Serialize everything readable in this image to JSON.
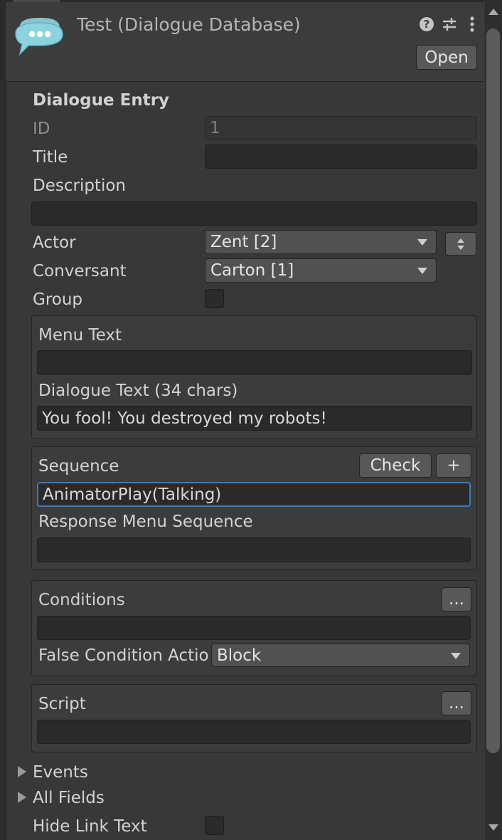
{
  "header": {
    "title": "Test (Dialogue Database)",
    "open_label": "Open",
    "icons": [
      "help-icon",
      "settings-sliders-icon",
      "kebab-menu-icon"
    ]
  },
  "entry": {
    "section_title": "Dialogue Entry",
    "id_label": "ID",
    "id_value": "1",
    "title_label": "Title",
    "title_value": "",
    "description_label": "Description",
    "description_value": "",
    "actor_label": "Actor",
    "actor_value": "Zent [2]",
    "conversant_label": "Conversant",
    "conversant_value": "Carton [1]",
    "group_label": "Group",
    "group_checked": false
  },
  "text_box": {
    "menu_text_label": "Menu Text",
    "menu_text_value": "",
    "dialogue_text_label": "Dialogue Text (34 chars)",
    "dialogue_text_value": "You fool! You destroyed my robots!"
  },
  "sequence_box": {
    "sequence_label": "Sequence",
    "check_label": "Check",
    "plus_label": "+",
    "sequence_value": "AnimatorPlay(Talking)",
    "response_label": "Response Menu Sequence",
    "response_value": ""
  },
  "conditions_box": {
    "conditions_label": "Conditions",
    "more_label": "...",
    "conditions_value": "",
    "false_action_label": "False Condition Actio",
    "false_action_value": "Block"
  },
  "script_box": {
    "script_label": "Script",
    "more_label": "...",
    "script_value": ""
  },
  "footer": {
    "events_label": "Events",
    "all_fields_label": "All Fields",
    "hide_link_label": "Hide Link Text",
    "hide_link_checked": false
  },
  "colors": {
    "background": "#383838",
    "field": "#2a2a2a",
    "focus": "#3a79bb",
    "logo": "#8cd3e0"
  }
}
